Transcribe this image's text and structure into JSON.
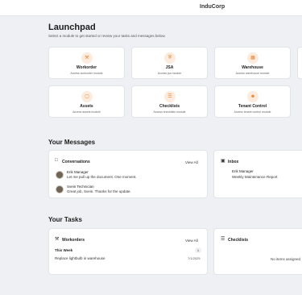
{
  "header": {
    "brand": "InduCorp"
  },
  "launchpad": {
    "title": "Launchpad",
    "subtitle": "Select a module to get started or review your tasks and messages below.",
    "modules": [
      {
        "name": "Workorder",
        "desc": "Access workorder module",
        "icon": "wrench-icon"
      },
      {
        "name": "JSA",
        "desc": "Access jsa module",
        "icon": "shield-icon"
      },
      {
        "name": "Warehouse",
        "desc": "Access warehouse module",
        "icon": "warehouse-icon"
      },
      {
        "name": "Assets",
        "desc": "Access assets module",
        "icon": "box-icon"
      },
      {
        "name": "Checklists",
        "desc": "Access checklists module",
        "icon": "checklist-icon"
      },
      {
        "name": "Tenant Control",
        "desc": "Access tenant control module",
        "icon": "user-icon"
      }
    ]
  },
  "messages": {
    "title": "Your Messages",
    "conversations": {
      "title": "Conversations",
      "view_all": "View All",
      "items": [
        {
          "name": "Erik Manager",
          "text": "Let me pull up the document. One moment."
        },
        {
          "name": "Svein Technician",
          "text": "Great job, Svein. Thanks for the update."
        }
      ]
    },
    "inbox": {
      "title": "Inbox",
      "items": [
        {
          "name": "Erik Manager",
          "text": "Weekly Maintenance Report"
        }
      ]
    }
  },
  "tasks": {
    "title": "Your Tasks",
    "workorders": {
      "title": "Workorders",
      "view_all": "View All",
      "group_label": "This Week",
      "group_count": "1",
      "items": [
        {
          "text": "Replace lightbulb in warehouse",
          "date": "7/1/2025"
        }
      ]
    },
    "checklists": {
      "title": "Checklists",
      "empty": "No items assigned"
    }
  },
  "colors": {
    "accent": "#e8802f",
    "accent_bg": "#fdebdd"
  }
}
